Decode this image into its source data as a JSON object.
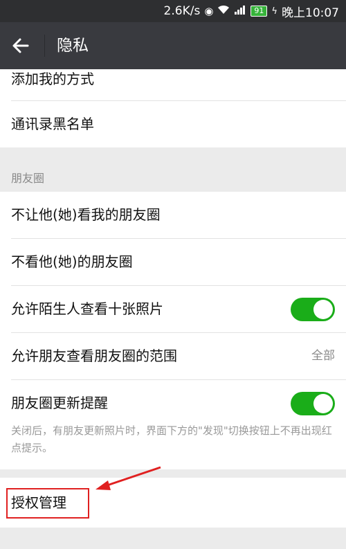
{
  "status_bar": {
    "speed": "2.6K/s",
    "battery": "91",
    "time": "晚上10:07"
  },
  "header": {
    "title": "隐私"
  },
  "top_group": {
    "items": [
      {
        "label": "添加我的方式"
      },
      {
        "label": "通讯录黑名单"
      }
    ]
  },
  "moments": {
    "section_title": "朋友圈",
    "items": [
      {
        "label": "不让他(她)看我的朋友圈"
      },
      {
        "label": "不看他(她)的朋友圈"
      },
      {
        "label": "允许陌生人查看十张照片",
        "toggle_on": true
      },
      {
        "label": "允许朋友查看朋友圈的范围",
        "value": "全部"
      },
      {
        "label": "朋友圈更新提醒",
        "toggle_on": true
      }
    ],
    "note": "关闭后，有朋友更新照片时，界面下方的\"发现\"切换按钮上不再出现红点提示。"
  },
  "auth": {
    "label": "授权管理"
  },
  "colors": {
    "accent_green": "#1aad19",
    "titlebar": "#393a3f",
    "annotation_red": "#e02020"
  }
}
